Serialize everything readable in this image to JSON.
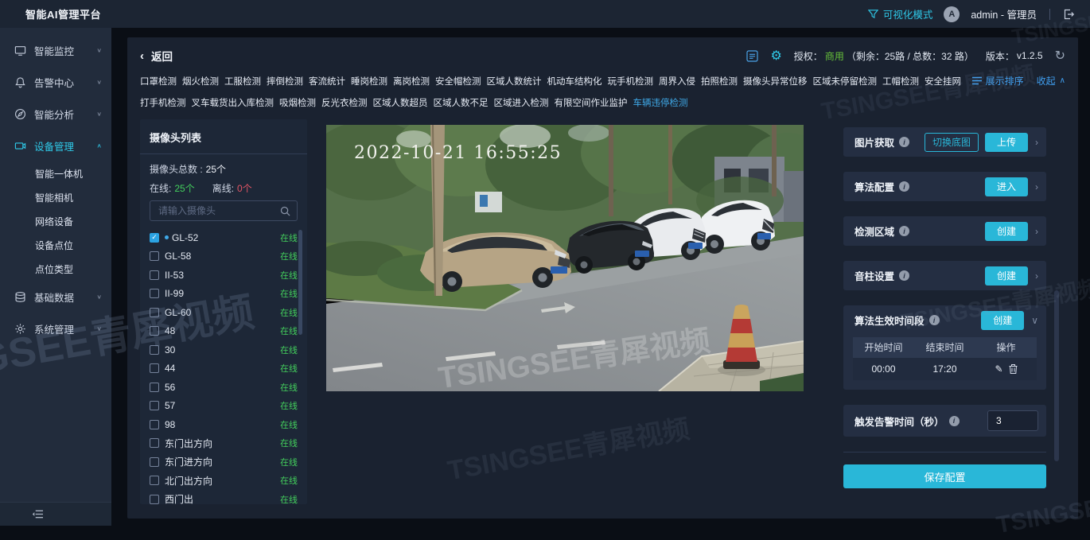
{
  "watermark": "TSINGSEE青犀视频",
  "app": {
    "title": "智能AI管理平台",
    "mode_label": "可视化模式",
    "user": "admin - 管理员",
    "avatar_letter": "A"
  },
  "sidebar": {
    "items": [
      {
        "label": "智能监控",
        "icon": "monitor"
      },
      {
        "label": "告警中心",
        "icon": "bell"
      },
      {
        "label": "智能分析",
        "icon": "analysis"
      },
      {
        "label": "设备管理",
        "icon": "device",
        "active": true,
        "children": [
          "智能一体机",
          "智能相机",
          "网络设备",
          "设备点位",
          "点位类型"
        ]
      },
      {
        "label": "基础数据",
        "icon": "database"
      },
      {
        "label": "系统管理",
        "icon": "settings"
      }
    ]
  },
  "header": {
    "back_label": "返回",
    "license_label": "授权：",
    "license_type": "商用",
    "license_detail": "（剩余：25路 / 总数：32 路）",
    "version_label": "版本：",
    "version": "v1.2.5"
  },
  "tabs": {
    "row1": [
      "口罩检测",
      "烟火检测",
      "工服检测",
      "摔倒检测",
      "客流统计",
      "睡岗检测",
      "离岗检测",
      "安全帽检测",
      "区域人数统计",
      "机动车结构化",
      "玩手机检测",
      "周界入侵",
      "拍照检测",
      "摄像头异常位移",
      "区域未停留检测",
      "工帽检测",
      "安全挂网"
    ],
    "row2": [
      "打手机检测",
      "叉车载货出入库检测",
      "吸烟检测",
      "反光衣检测",
      "区域人数超员",
      "区域人数不足",
      "区域进入检测",
      "有限空间作业监护",
      "车辆违停检测"
    ],
    "active": "车辆违停检测",
    "sort_label": "展示排序",
    "collapse_label": "收起"
  },
  "camera_panel": {
    "title": "摄像头列表",
    "total_label": "摄像头总数 :",
    "total_value": "25个",
    "online_label": "在线:",
    "online_value": "25个",
    "offline_label": "离线:",
    "offline_value": "0个",
    "search_placeholder": "请输入摄像头",
    "cameras": [
      {
        "name": "GL-52",
        "status": "在线",
        "checked": true
      },
      {
        "name": "GL-58",
        "status": "在线"
      },
      {
        "name": "II-53",
        "status": "在线"
      },
      {
        "name": "II-99",
        "status": "在线"
      },
      {
        "name": "GL-60",
        "status": "在线"
      },
      {
        "name": "48",
        "status": "在线"
      },
      {
        "name": "30",
        "status": "在线"
      },
      {
        "name": "44",
        "status": "在线"
      },
      {
        "name": "56",
        "status": "在线"
      },
      {
        "name": "57",
        "status": "在线"
      },
      {
        "name": "98",
        "status": "在线"
      },
      {
        "name": "东门出方向",
        "status": "在线"
      },
      {
        "name": "东门进方向",
        "status": "在线"
      },
      {
        "name": "北门出方向",
        "status": "在线"
      },
      {
        "name": "西门出",
        "status": "在线"
      }
    ]
  },
  "video": {
    "timestamp": "2022-10-21 16:55:25"
  },
  "config_panel": {
    "sections": [
      {
        "label": "图片获取",
        "secondary_button": "切换底图",
        "primary_button": "上传"
      },
      {
        "label": "算法配置",
        "primary_button": "进入"
      },
      {
        "label": "检测区域",
        "primary_button": "创建"
      },
      {
        "label": "音柱设置",
        "primary_button": "创建"
      },
      {
        "label": "算法生效时间段",
        "primary_button": "创建"
      }
    ],
    "time_table": {
      "headers": [
        "开始时间",
        "结束时间",
        "操作"
      ],
      "rows": [
        {
          "start": "00:00",
          "end": "17:20"
        }
      ]
    },
    "trigger_label": "触发告警时间（秒）",
    "trigger_value": "3",
    "save_label": "保存配置"
  }
}
